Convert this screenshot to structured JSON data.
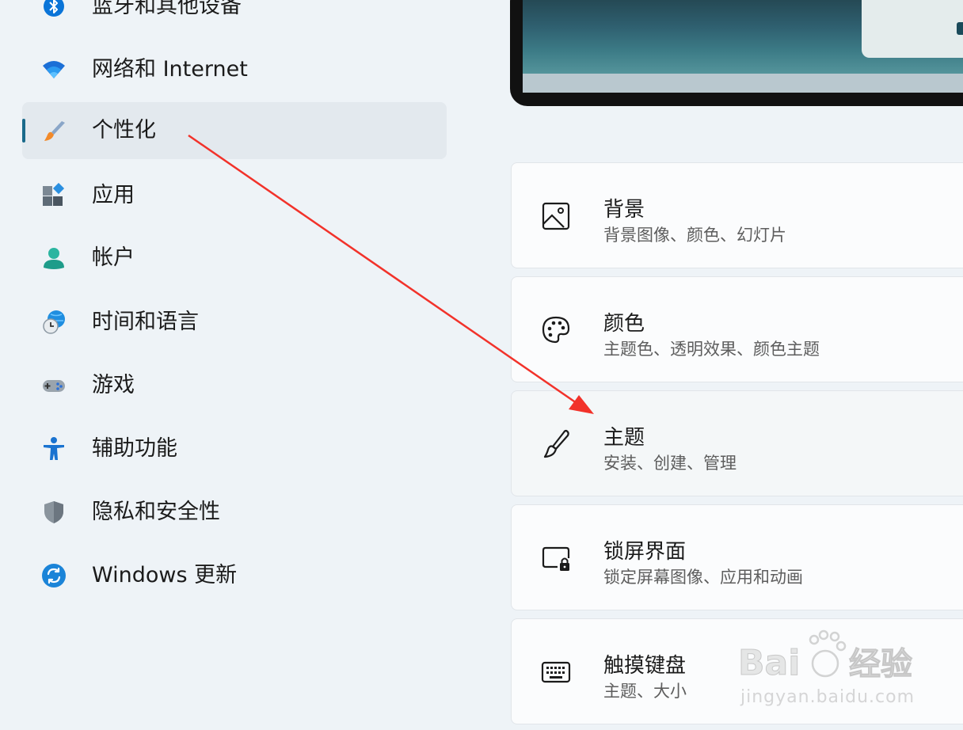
{
  "sidebar": {
    "items": [
      {
        "label": "蓝牙和其他设备",
        "icon": "bluetooth-icon"
      },
      {
        "label": "网络和 Internet",
        "icon": "wifi-icon"
      },
      {
        "label": "个性化",
        "icon": "paintbrush-icon",
        "selected": true
      },
      {
        "label": "应用",
        "icon": "apps-icon"
      },
      {
        "label": "帐户",
        "icon": "account-icon"
      },
      {
        "label": "时间和语言",
        "icon": "time-language-icon"
      },
      {
        "label": "游戏",
        "icon": "gamepad-icon"
      },
      {
        "label": "辅助功能",
        "icon": "accessibility-icon"
      },
      {
        "label": "隐私和安全性",
        "icon": "shield-icon"
      },
      {
        "label": "Windows 更新",
        "icon": "sync-icon"
      }
    ]
  },
  "settings": [
    {
      "title": "背景",
      "subtitle": "背景图像、颜色、幻灯片",
      "icon": "image-icon"
    },
    {
      "title": "颜色",
      "subtitle": "主题色、透明效果、颜色主题",
      "icon": "palette-icon"
    },
    {
      "title": "主题",
      "subtitle": "安装、创建、管理",
      "icon": "brush-icon"
    },
    {
      "title": "锁屏界面",
      "subtitle": "锁定屏幕图像、应用和动画",
      "icon": "lock-screen-icon"
    },
    {
      "title": "触摸键盘",
      "subtitle": "主题、大小",
      "icon": "keyboard-icon"
    }
  ],
  "watermark": {
    "brand": "Baidu经验",
    "url": "jingyan.baidu.com"
  },
  "colors": {
    "accent": "#1a6a8a",
    "annotation_arrow": "#f2322a"
  }
}
